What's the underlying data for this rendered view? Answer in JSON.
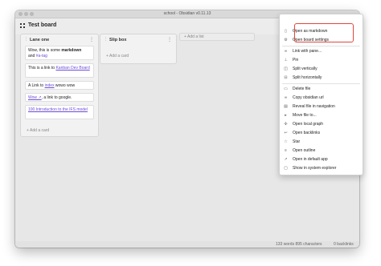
{
  "window": {
    "title": "school - Obsidian v0.11.13"
  },
  "board": {
    "title": "Test board"
  },
  "lanes": [
    {
      "title": "Lane one",
      "cards": [
        {
          "pre": "Wow, this is some ",
          "bold": "markdown",
          "mid": " and ",
          "tag": "#a-tag"
        },
        {
          "pre": "This is a link to ",
          "link": "Kanban Dev Board"
        },
        {
          "pre": "A Link to ",
          "link": "index",
          "post": " wowo wow"
        },
        {
          "link": "Wow ↗",
          "post": ", a link to google."
        },
        {
          "link": "100 Introduction to the IFS model"
        }
      ],
      "add_card": "+ Add a card"
    },
    {
      "title": "Slip box",
      "cards": [],
      "add_card": "+ Add a card"
    }
  ],
  "add_list": "+ Add a list",
  "status": {
    "words": "133 words 895 characters",
    "backlinks": "0 backlinks"
  },
  "context_menu": {
    "items": [
      {
        "label": "Open as markdown",
        "icon": "document-icon"
      },
      {
        "label": "Open board settings",
        "icon": "gear-icon"
      },
      {
        "label": "Link with pane...",
        "icon": "link-icon"
      },
      {
        "label": "Pin",
        "icon": "pin-icon"
      },
      {
        "label": "Split vertically",
        "icon": "split-vertical-icon"
      },
      {
        "label": "Split horizontally",
        "icon": "split-horizontal-icon"
      },
      {
        "label": "Delete file",
        "icon": "trash-icon"
      },
      {
        "label": "Copy obsidian url",
        "icon": "link-icon"
      },
      {
        "label": "Reveal file in navigation",
        "icon": "folder-icon"
      },
      {
        "label": "Move file to...",
        "icon": "move-icon"
      },
      {
        "label": "Open local graph",
        "icon": "graph-icon"
      },
      {
        "label": "Open backlinks",
        "icon": "backlinks-icon"
      },
      {
        "label": "Star",
        "icon": "star-icon"
      },
      {
        "label": "Open outline",
        "icon": "outline-icon"
      },
      {
        "label": "Open in default app",
        "icon": "external-app-icon"
      },
      {
        "label": "Show in system explorer",
        "icon": "explorer-icon"
      }
    ]
  },
  "colors": {
    "accent": "#6c4bd8",
    "highlight": "#e0473b"
  }
}
